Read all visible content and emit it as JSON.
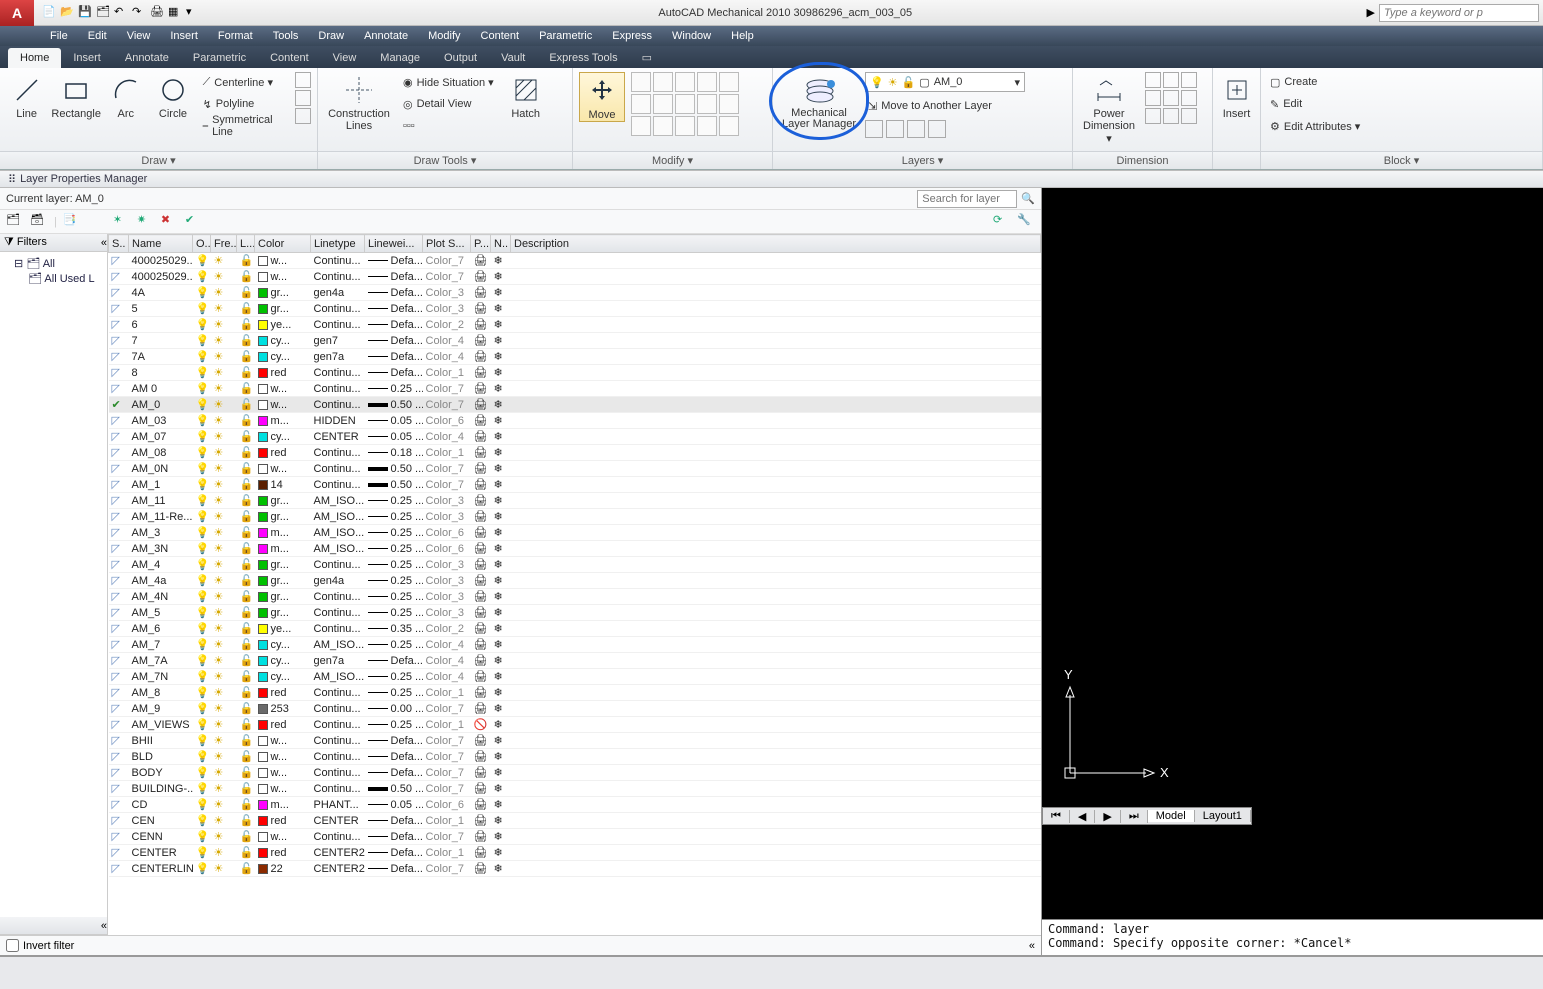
{
  "app": {
    "title": "AutoCAD Mechanical 2010     30986296_acm_003_05",
    "search_placeholder": "Type a keyword or p"
  },
  "menus": [
    "File",
    "Edit",
    "View",
    "Insert",
    "Format",
    "Tools",
    "Draw",
    "Annotate",
    "Modify",
    "Content",
    "Parametric",
    "Express",
    "Window",
    "Help"
  ],
  "ribbon_tabs": [
    "Home",
    "Insert",
    "Annotate",
    "Parametric",
    "Content",
    "View",
    "Manage",
    "Output",
    "Vault",
    "Express Tools"
  ],
  "ribbon": {
    "panels": [
      "Draw ▾",
      "Draw Tools ▾",
      "",
      "",
      "Modify ▾",
      "",
      "Layers ▾",
      "Dimension",
      "",
      "Block ▾"
    ],
    "draw": {
      "line": "Line",
      "rectangle": "Rectangle",
      "arc": "Arc",
      "circle": "Circle",
      "centerline": "Centerline ▾",
      "polyline": "Polyline",
      "symline": "Symmetrical Line"
    },
    "drawtools": {
      "construction": "Construction Lines",
      "hidesituation": "Hide Situation ▾",
      "detailview": "Detail View",
      "hatch": "Hatch"
    },
    "modify": {
      "move": "Move"
    },
    "layers": {
      "mlm": "Mechanical Layer Manager",
      "current": "AM_0",
      "moveto": "Move to Another Layer"
    },
    "dimension": {
      "power": "Power Dimension ▾"
    },
    "insert": {
      "insert": "Insert"
    },
    "block": {
      "create": "Create",
      "edit": "Edit",
      "editattrs": "Edit Attributes ▾"
    }
  },
  "lpm": {
    "title": "Layer Properties Manager",
    "current_label": "Current layer: AM_0",
    "search_placeholder": "Search for layer",
    "filters_label": "Filters",
    "tree": [
      "All",
      "All Used L"
    ],
    "invert": "Invert filter",
    "cols": {
      "s": "S..",
      "name": "Name",
      "o": "O..",
      "fre": "Fre...",
      "l": "L...",
      "color": "Color",
      "linetype": "Linetype",
      "linewei": "Linewei...",
      "plots": "Plot S...",
      "p": "P...",
      "n": "N..",
      "desc": "Description"
    },
    "layers": [
      {
        "name": "400025029...",
        "color": "w...",
        "hex": "#ffffff",
        "lt": "Continu...",
        "lw": "Defa...",
        "ps": "Color_7"
      },
      {
        "name": "400025029...",
        "color": "w...",
        "hex": "#ffffff",
        "lt": "Continu...",
        "lw": "Defa...",
        "ps": "Color_7"
      },
      {
        "name": "4A",
        "color": "gr...",
        "hex": "#00c000",
        "lt": "gen4a",
        "lw": "Defa...",
        "ps": "Color_3"
      },
      {
        "name": "5",
        "color": "gr...",
        "hex": "#00c000",
        "lt": "Continu...",
        "lw": "Defa...",
        "ps": "Color_3"
      },
      {
        "name": "6",
        "color": "ye...",
        "hex": "#ffff00",
        "lt": "Continu...",
        "lw": "Defa...",
        "ps": "Color_2"
      },
      {
        "name": "7",
        "color": "cy...",
        "hex": "#00e0e0",
        "lt": "gen7",
        "lw": "Defa...",
        "ps": "Color_4"
      },
      {
        "name": "7A",
        "color": "cy...",
        "hex": "#00e0e0",
        "lt": "gen7a",
        "lw": "Defa...",
        "ps": "Color_4"
      },
      {
        "name": "8",
        "color": "red",
        "hex": "#ff0000",
        "lt": "Continu...",
        "lw": "Defa...",
        "ps": "Color_1"
      },
      {
        "name": "AM 0",
        "color": "w...",
        "hex": "#ffffff",
        "lt": "Continu...",
        "lw": "0.25 ...",
        "ps": "Color_7"
      },
      {
        "name": "AM_0",
        "color": "w...",
        "hex": "#ffffff",
        "lt": "Continu...",
        "lw": "0.50 ...",
        "ps": "Color_7",
        "current": true,
        "thick": true
      },
      {
        "name": "AM_03",
        "color": "m...",
        "hex": "#ff00ff",
        "lt": "HIDDEN",
        "lw": "0.05 ...",
        "ps": "Color_6"
      },
      {
        "name": "AM_07",
        "color": "cy...",
        "hex": "#00e0e0",
        "lt": "CENTER",
        "lw": "0.05 ...",
        "ps": "Color_4"
      },
      {
        "name": "AM_08",
        "color": "red",
        "hex": "#ff0000",
        "lt": "Continu...",
        "lw": "0.18 ...",
        "ps": "Color_1"
      },
      {
        "name": "AM_0N",
        "color": "w...",
        "hex": "#ffffff",
        "lt": "Continu...",
        "lw": "0.50 ...",
        "ps": "Color_7",
        "thick": true
      },
      {
        "name": "AM_1",
        "color": "14",
        "hex": "#5a1f00",
        "lt": "Continu...",
        "lw": "0.50 ...",
        "ps": "Color_7",
        "thick": true
      },
      {
        "name": "AM_11",
        "color": "gr...",
        "hex": "#00c000",
        "lt": "AM_ISO...",
        "lw": "0.25 ...",
        "ps": "Color_3"
      },
      {
        "name": "AM_11-Re...",
        "color": "gr...",
        "hex": "#00c000",
        "lt": "AM_ISO...",
        "lw": "0.25 ...",
        "ps": "Color_3"
      },
      {
        "name": "AM_3",
        "color": "m...",
        "hex": "#ff00ff",
        "lt": "AM_ISO...",
        "lw": "0.25 ...",
        "ps": "Color_6"
      },
      {
        "name": "AM_3N",
        "color": "m...",
        "hex": "#ff00ff",
        "lt": "AM_ISO...",
        "lw": "0.25 ...",
        "ps": "Color_6"
      },
      {
        "name": "AM_4",
        "color": "gr...",
        "hex": "#00c000",
        "lt": "Continu...",
        "lw": "0.25 ...",
        "ps": "Color_3"
      },
      {
        "name": "AM_4a",
        "color": "gr...",
        "hex": "#00c000",
        "lt": "gen4a",
        "lw": "0.25 ...",
        "ps": "Color_3"
      },
      {
        "name": "AM_4N",
        "color": "gr...",
        "hex": "#00c000",
        "lt": "Continu...",
        "lw": "0.25 ...",
        "ps": "Color_3"
      },
      {
        "name": "AM_5",
        "color": "gr...",
        "hex": "#00c000",
        "lt": "Continu...",
        "lw": "0.25 ...",
        "ps": "Color_3"
      },
      {
        "name": "AM_6",
        "color": "ye...",
        "hex": "#ffff00",
        "lt": "Continu...",
        "lw": "0.35 ...",
        "ps": "Color_2"
      },
      {
        "name": "AM_7",
        "color": "cy...",
        "hex": "#00e0e0",
        "lt": "AM_ISO...",
        "lw": "0.25 ...",
        "ps": "Color_4"
      },
      {
        "name": "AM_7A",
        "color": "cy...",
        "hex": "#00e0e0",
        "lt": "gen7a",
        "lw": "Defa...",
        "ps": "Color_4"
      },
      {
        "name": "AM_7N",
        "color": "cy...",
        "hex": "#00e0e0",
        "lt": "AM_ISO...",
        "lw": "0.25 ...",
        "ps": "Color_4"
      },
      {
        "name": "AM_8",
        "color": "red",
        "hex": "#ff0000",
        "lt": "Continu...",
        "lw": "0.25 ...",
        "ps": "Color_1"
      },
      {
        "name": "AM_9",
        "color": "253",
        "hex": "#6a6a6a",
        "lt": "Continu...",
        "lw": "0.00 ...",
        "ps": "Color_7"
      },
      {
        "name": "AM_VIEWS",
        "color": "red",
        "hex": "#ff0000",
        "lt": "Continu...",
        "lw": "0.25 ...",
        "ps": "Color_1",
        "noplot": true
      },
      {
        "name": "BHII",
        "color": "w...",
        "hex": "#ffffff",
        "lt": "Continu...",
        "lw": "Defa...",
        "ps": "Color_7"
      },
      {
        "name": "BLD",
        "color": "w...",
        "hex": "#ffffff",
        "lt": "Continu...",
        "lw": "Defa...",
        "ps": "Color_7"
      },
      {
        "name": "BODY",
        "color": "w...",
        "hex": "#ffffff",
        "lt": "Continu...",
        "lw": "Defa...",
        "ps": "Color_7"
      },
      {
        "name": "BUILDING-...",
        "color": "w...",
        "hex": "#ffffff",
        "lt": "Continu...",
        "lw": "0.50 ...",
        "ps": "Color_7",
        "thick": true
      },
      {
        "name": "CD",
        "color": "m...",
        "hex": "#ff00ff",
        "lt": "PHANT...",
        "lw": "0.05 ...",
        "ps": "Color_6"
      },
      {
        "name": "CEN",
        "color": "red",
        "hex": "#ff0000",
        "lt": "CENTER",
        "lw": "Defa...",
        "ps": "Color_1"
      },
      {
        "name": "CENN",
        "color": "w...",
        "hex": "#ffffff",
        "lt": "Continu...",
        "lw": "Defa...",
        "ps": "Color_7"
      },
      {
        "name": "CENTER",
        "color": "red",
        "hex": "#ff0000",
        "lt": "CENTER2",
        "lw": "Defa...",
        "ps": "Color_1"
      },
      {
        "name": "CENTERLINE",
        "color": "22",
        "hex": "#8b2a00",
        "lt": "CENTER2",
        "lw": "Defa...",
        "ps": "Color_7"
      }
    ]
  },
  "tabs_bottom": {
    "model": "Model",
    "layout": "Layout1"
  },
  "cmd": {
    "l1": "Command: layer",
    "l2": "Command: Specify opposite corner: *Cancel*"
  }
}
